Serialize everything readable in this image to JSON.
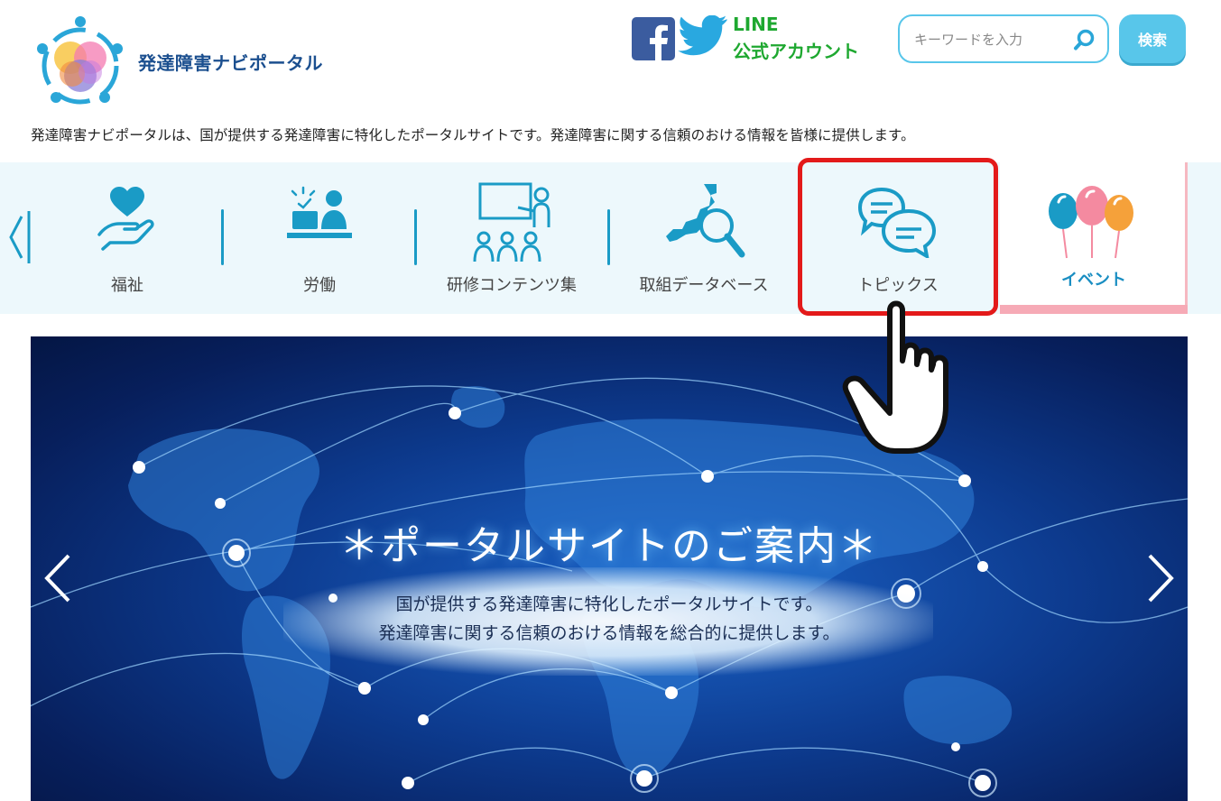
{
  "header": {
    "site_title": "発達障害ナビポータル",
    "line_label_1": "LINE",
    "line_label_2": "公式アカウント",
    "search_placeholder": "キーワードを入力",
    "search_value": "",
    "search_button": "検索",
    "tagline": "発達障害ナビポータルは、国が提供する発達障害に特化したポータルサイトです。発達障害に関する信頼のおける情報を皆様に提供します。"
  },
  "nav": {
    "items": [
      {
        "label": "福祉",
        "icon": "heart-hand-icon"
      },
      {
        "label": "労働",
        "icon": "office-worker-icon"
      },
      {
        "label": "研修コンテンツ集",
        "icon": "training-presentation-icon"
      },
      {
        "label": "取組データベース",
        "icon": "japan-map-search-icon"
      },
      {
        "label": "トピックス",
        "icon": "speech-bubbles-icon"
      },
      {
        "label": "イベント",
        "icon": "balloons-icon"
      }
    ]
  },
  "banner": {
    "title": "＊ポータルサイトのご案内＊",
    "line1": "国が提供する発達障害に特化したポータルサイトです。",
    "line2": "発達障害に関する信頼のおける情報を総合的に提供します。"
  },
  "colors": {
    "accent": "#58c6ea",
    "nav_bg": "#edf8fc",
    "highlight": "#e31a1a",
    "line_green": "#1ea830",
    "title_blue": "#1b4f8f"
  }
}
